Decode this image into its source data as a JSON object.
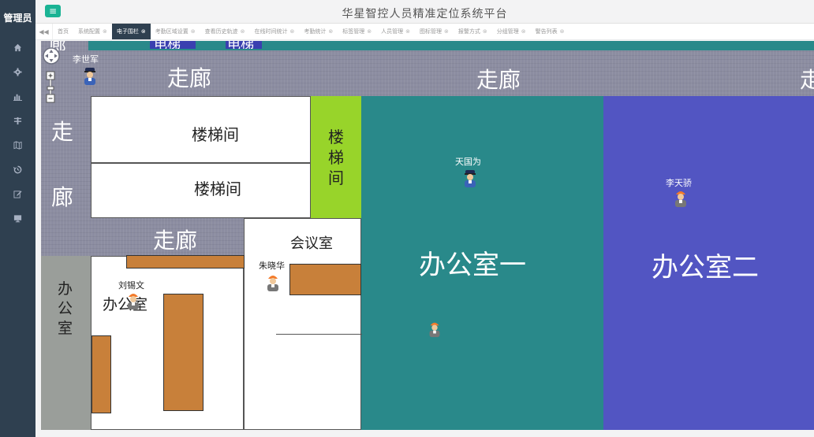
{
  "sidebar": {
    "brand": "管理员",
    "items": [
      {
        "icon": "home-icon"
      },
      {
        "icon": "gear-icon"
      },
      {
        "icon": "bar-chart-icon"
      },
      {
        "icon": "sliders-icon"
      },
      {
        "icon": "map-icon"
      },
      {
        "icon": "history-icon"
      },
      {
        "icon": "edit-icon"
      },
      {
        "icon": "monitor-icon"
      }
    ]
  },
  "header": {
    "menu_icon": "≡",
    "title": "华星智控人员精准定位系统平台"
  },
  "tabs": [
    {
      "label": "首页",
      "active": false,
      "closable": false
    },
    {
      "label": "系统配置",
      "active": false,
      "closable": true
    },
    {
      "label": "电子围栏",
      "active": true,
      "closable": true
    },
    {
      "label": "考勤区域设置",
      "active": false,
      "closable": true
    },
    {
      "label": "查看历史轨迹",
      "active": false,
      "closable": true
    },
    {
      "label": "在线时间统计",
      "active": false,
      "closable": true
    },
    {
      "label": "考勤统计",
      "active": false,
      "closable": true
    },
    {
      "label": "标签管理",
      "active": false,
      "closable": true
    },
    {
      "label": "人员管理",
      "active": false,
      "closable": true
    },
    {
      "label": "图标管理",
      "active": false,
      "closable": true
    },
    {
      "label": "报警方式",
      "active": false,
      "closable": true
    },
    {
      "label": "分组管理",
      "active": false,
      "closable": true
    },
    {
      "label": "警告列表",
      "active": false,
      "closable": true
    }
  ],
  "map": {
    "labels": {
      "corridor_top_left": "走廊",
      "corridor_top_mid": "走廊",
      "corridor_top_right_partial": "走",
      "corridor_left_1": "走",
      "corridor_left_2": "廊",
      "stair_1": "楼梯间",
      "stair_2": "楼梯间",
      "stair_green": [
        "楼",
        "梯",
        "间"
      ],
      "corridor_mid": "走廊",
      "meeting_room": "会议室",
      "office_left_vertical": [
        "办",
        "公",
        "室"
      ],
      "office_small": "办公室",
      "office_1": "办公室一",
      "office_2": "办公室二",
      "elevator_1": "电梯",
      "elevator_2": "电梯",
      "partial_top_left": "廊"
    },
    "people": [
      {
        "name": "李世军",
        "type": "police"
      },
      {
        "name": "天国为",
        "type": "police"
      },
      {
        "name": "李天骄",
        "type": "worker"
      },
      {
        "name": "朱晓华",
        "type": "worker"
      },
      {
        "name": "刘锡文",
        "type": "worker"
      },
      {
        "name": "",
        "type": "worker"
      }
    ],
    "colors": {
      "corridor": "#8e8fa3",
      "room_white": "#ffffff",
      "stair_green": "#98d42a",
      "office_teal": "#29898a",
      "office_blue": "#5255c2",
      "office_gray": "#9a9e9a",
      "furniture": "#c8803a"
    }
  }
}
